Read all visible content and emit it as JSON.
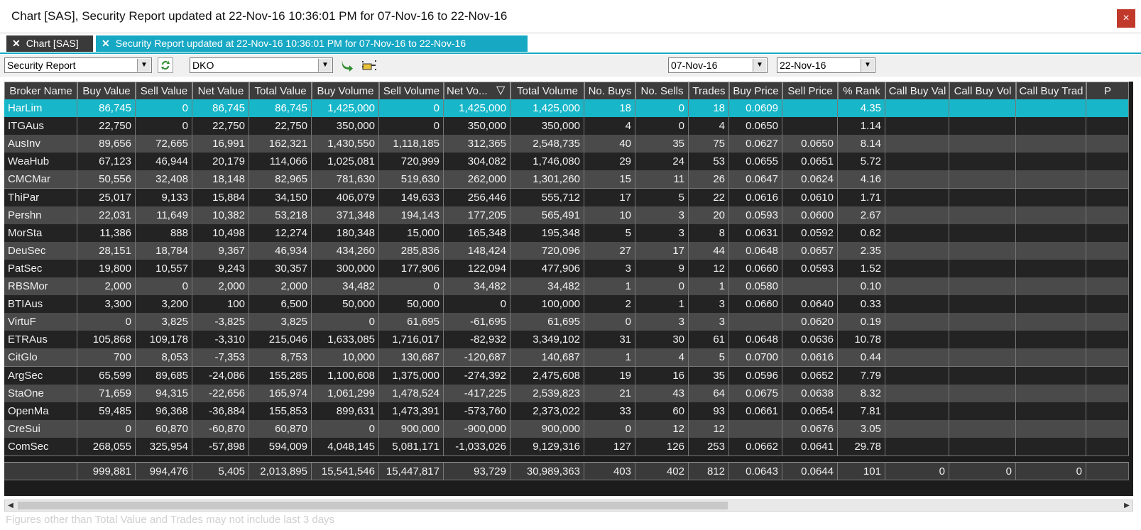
{
  "window": {
    "title": "Chart [SAS], Security Report updated at 22-Nov-16 10:36:01 PM for 07-Nov-16 to 22-Nov-16",
    "close_glyph": "×"
  },
  "tabs": [
    {
      "close": "✕",
      "label": "Chart [SAS]"
    },
    {
      "close": "✕",
      "label": "Security Report updated at 22-Nov-16 10:36:01 PM for 07-Nov-16 to 22-Nov-16"
    }
  ],
  "toolbar": {
    "report_type": "Security Report",
    "security": "DKO",
    "date_from": "07-Nov-16",
    "date_to": "22-Nov-16",
    "refresh_icon": "refresh-icon",
    "go_icon": "arrow-go-icon",
    "pointer_icon": "hand-pointer-icon"
  },
  "grid": {
    "columns": [
      "Broker Name",
      "Buy Value",
      "Sell Value",
      "Net Value",
      "Total Value",
      "Buy Volume",
      "Sell Volume",
      "Net Vo...",
      "Total Volume",
      "No. Buys",
      "No. Sells",
      "Trades",
      "Buy Price",
      "Sell Price",
      "% Rank",
      "Call Buy Val",
      "Call Buy Vol",
      "Call Buy Trad",
      "P"
    ],
    "sort_indicator": "▽",
    "rows": [
      [
        "HarLim",
        "86,745",
        "0",
        "86,745",
        "86,745",
        "1,425,000",
        "0",
        "1,425,000",
        "1,425,000",
        "18",
        "0",
        "18",
        "0.0609",
        "",
        "4.35",
        "",
        "",
        "",
        ""
      ],
      [
        "ITGAus",
        "22,750",
        "0",
        "22,750",
        "22,750",
        "350,000",
        "0",
        "350,000",
        "350,000",
        "4",
        "0",
        "4",
        "0.0650",
        "",
        "1.14",
        "",
        "",
        "",
        ""
      ],
      [
        "AusInv",
        "89,656",
        "72,665",
        "16,991",
        "162,321",
        "1,430,550",
        "1,118,185",
        "312,365",
        "2,548,735",
        "40",
        "35",
        "75",
        "0.0627",
        "0.0650",
        "8.14",
        "",
        "",
        "",
        ""
      ],
      [
        "WeaHub",
        "67,123",
        "46,944",
        "20,179",
        "114,066",
        "1,025,081",
        "720,999",
        "304,082",
        "1,746,080",
        "29",
        "24",
        "53",
        "0.0655",
        "0.0651",
        "5.72",
        "",
        "",
        "",
        ""
      ],
      [
        "CMCMar",
        "50,556",
        "32,408",
        "18,148",
        "82,965",
        "781,630",
        "519,630",
        "262,000",
        "1,301,260",
        "15",
        "11",
        "26",
        "0.0647",
        "0.0624",
        "4.16",
        "",
        "",
        "",
        ""
      ],
      [
        "ThiPar",
        "25,017",
        "9,133",
        "15,884",
        "34,150",
        "406,079",
        "149,633",
        "256,446",
        "555,712",
        "17",
        "5",
        "22",
        "0.0616",
        "0.0610",
        "1.71",
        "",
        "",
        "",
        ""
      ],
      [
        "Pershn",
        "22,031",
        "11,649",
        "10,382",
        "53,218",
        "371,348",
        "194,143",
        "177,205",
        "565,491",
        "10",
        "3",
        "20",
        "0.0593",
        "0.0600",
        "2.67",
        "",
        "",
        "",
        ""
      ],
      [
        "MorSta",
        "11,386",
        "888",
        "10,498",
        "12,274",
        "180,348",
        "15,000",
        "165,348",
        "195,348",
        "5",
        "3",
        "8",
        "0.0631",
        "0.0592",
        "0.62",
        "",
        "",
        "",
        ""
      ],
      [
        "DeuSec",
        "28,151",
        "18,784",
        "9,367",
        "46,934",
        "434,260",
        "285,836",
        "148,424",
        "720,096",
        "27",
        "17",
        "44",
        "0.0648",
        "0.0657",
        "2.35",
        "",
        "",
        "",
        ""
      ],
      [
        "PatSec",
        "19,800",
        "10,557",
        "9,243",
        "30,357",
        "300,000",
        "177,906",
        "122,094",
        "477,906",
        "3",
        "9",
        "12",
        "0.0660",
        "0.0593",
        "1.52",
        "",
        "",
        "",
        ""
      ],
      [
        "RBSMor",
        "2,000",
        "0",
        "2,000",
        "2,000",
        "34,482",
        "0",
        "34,482",
        "34,482",
        "1",
        "0",
        "1",
        "0.0580",
        "",
        "0.10",
        "",
        "",
        "",
        ""
      ],
      [
        "BTIAus",
        "3,300",
        "3,200",
        "100",
        "6,500",
        "50,000",
        "50,000",
        "0",
        "100,000",
        "2",
        "1",
        "3",
        "0.0660",
        "0.0640",
        "0.33",
        "",
        "",
        "",
        ""
      ],
      [
        "VirtuF",
        "0",
        "3,825",
        "-3,825",
        "3,825",
        "0",
        "61,695",
        "-61,695",
        "61,695",
        "0",
        "3",
        "3",
        "",
        "0.0620",
        "0.19",
        "",
        "",
        "",
        ""
      ],
      [
        "ETRAus",
        "105,868",
        "109,178",
        "-3,310",
        "215,046",
        "1,633,085",
        "1,716,017",
        "-82,932",
        "3,349,102",
        "31",
        "30",
        "61",
        "0.0648",
        "0.0636",
        "10.78",
        "",
        "",
        "",
        ""
      ],
      [
        "CitGlo",
        "700",
        "8,053",
        "-7,353",
        "8,753",
        "10,000",
        "130,687",
        "-120,687",
        "140,687",
        "1",
        "4",
        "5",
        "0.0700",
        "0.0616",
        "0.44",
        "",
        "",
        "",
        ""
      ],
      [
        "ArgSec",
        "65,599",
        "89,685",
        "-24,086",
        "155,285",
        "1,100,608",
        "1,375,000",
        "-274,392",
        "2,475,608",
        "19",
        "16",
        "35",
        "0.0596",
        "0.0652",
        "7.79",
        "",
        "",
        "",
        ""
      ],
      [
        "StaOne",
        "71,659",
        "94,315",
        "-22,656",
        "165,974",
        "1,061,299",
        "1,478,524",
        "-417,225",
        "2,539,823",
        "21",
        "43",
        "64",
        "0.0675",
        "0.0638",
        "8.32",
        "",
        "",
        "",
        ""
      ],
      [
        "OpenMa",
        "59,485",
        "96,368",
        "-36,884",
        "155,853",
        "899,631",
        "1,473,391",
        "-573,760",
        "2,373,022",
        "33",
        "60",
        "93",
        "0.0661",
        "0.0654",
        "7.81",
        "",
        "",
        "",
        ""
      ],
      [
        "CreSui",
        "0",
        "60,870",
        "-60,870",
        "60,870",
        "0",
        "900,000",
        "-900,000",
        "900,000",
        "0",
        "12",
        "12",
        "",
        "0.0676",
        "3.05",
        "",
        "",
        "",
        ""
      ],
      [
        "ComSec",
        "268,055",
        "325,954",
        "-57,898",
        "594,009",
        "4,048,145",
        "5,081,171",
        "-1,033,026",
        "9,129,316",
        "127",
        "126",
        "253",
        "0.0662",
        "0.0641",
        "29.78",
        "",
        "",
        "",
        ""
      ]
    ],
    "totals": [
      "",
      "999,881",
      "994,476",
      "5,405",
      "2,013,895",
      "15,541,546",
      "15,447,817",
      "93,729",
      "30,989,363",
      "403",
      "402",
      "812",
      "0.0643",
      "0.0644",
      "101",
      "0",
      "0",
      "0",
      ""
    ]
  },
  "scrollbar": {
    "left_arrow": "◀",
    "right_arrow": "▶"
  },
  "footnote": "Figures other than Total Value and Trades may not include last 3 days"
}
